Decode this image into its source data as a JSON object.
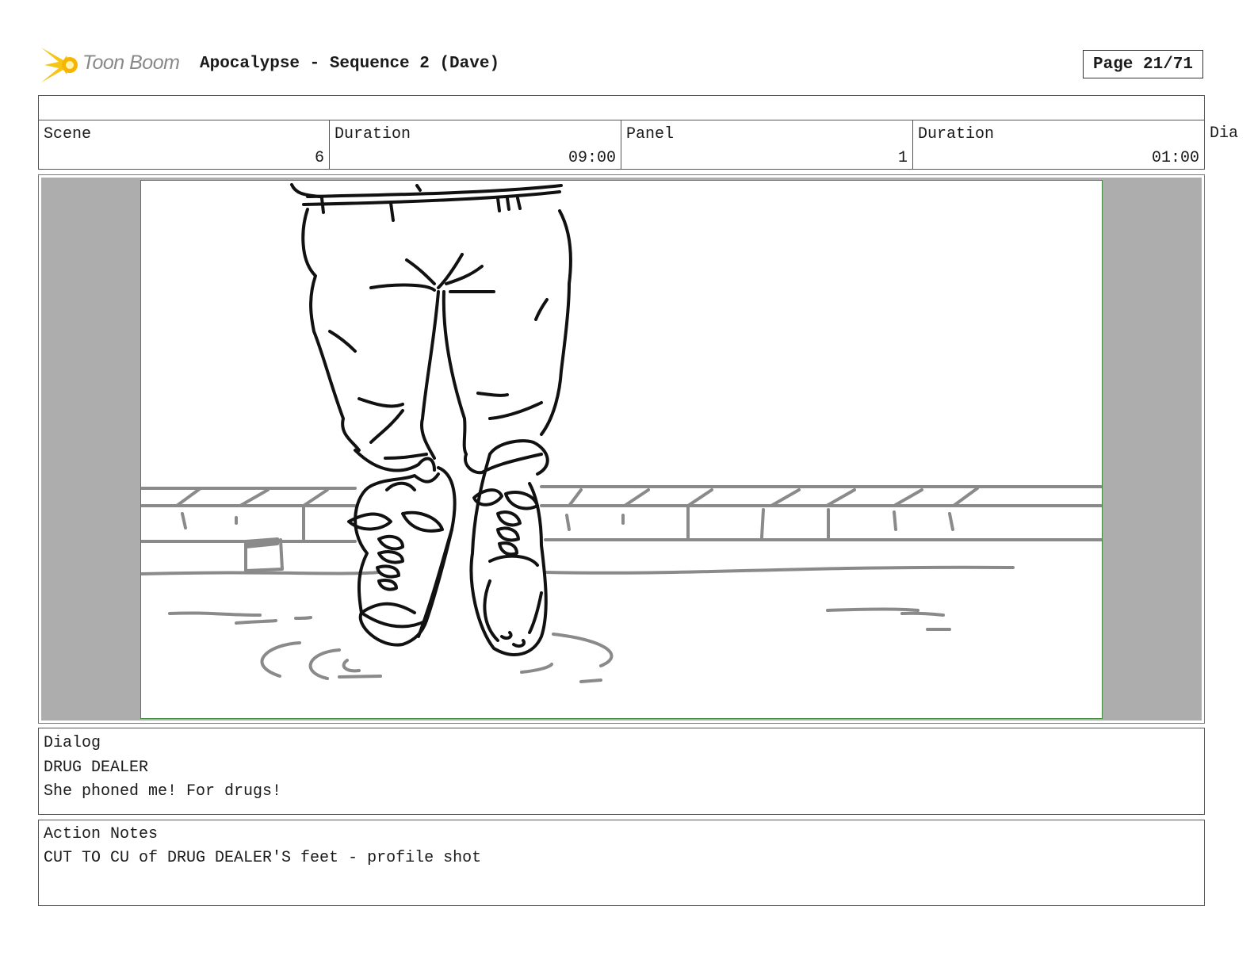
{
  "header": {
    "brand": "Toon Boom",
    "title": "Apocalypse - Sequence 2 (Dave)",
    "page": "Page 21/71"
  },
  "info": {
    "scene_label": "Scene",
    "scene_value": "6",
    "scene_duration_label": "Duration",
    "scene_duration_value": "09:00",
    "panel_label": "Panel",
    "panel_value": "1",
    "panel_duration_label": "Duration",
    "panel_duration_value": "01:00",
    "cut_off_label": "Dia"
  },
  "dialog": {
    "label": "Dialog",
    "character": "DRUG DEALER",
    "line": "She phoned me! For drugs!"
  },
  "action_notes": {
    "label": "Action Notes",
    "text": "CUT TO CU of DRUG DEALER'S feet - profile shot"
  },
  "colors": {
    "panel_border": "#3f8a3f",
    "letterbox": "#adadad",
    "logo_yellow": "#f5c518"
  }
}
